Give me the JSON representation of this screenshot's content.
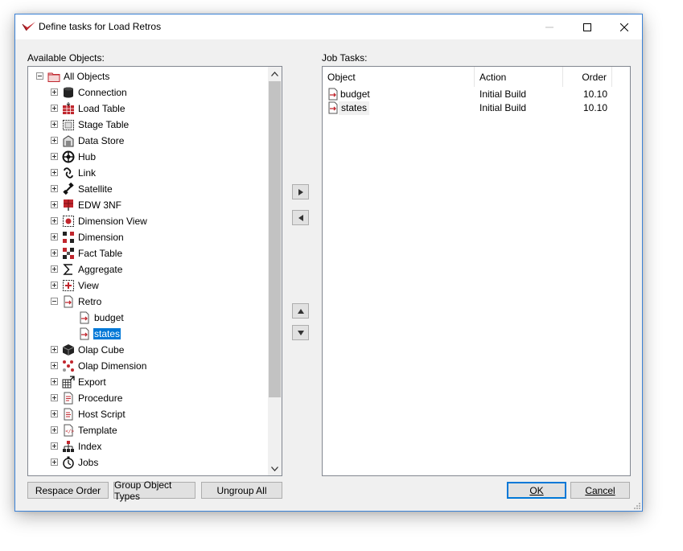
{
  "window": {
    "title": "Define tasks for Load Retros"
  },
  "left": {
    "label": "Available Objects:",
    "tree": [
      {
        "label": "All Objects",
        "icon": "folder-icon",
        "level": 0,
        "expander": "minus"
      },
      {
        "label": "Connection",
        "icon": "database-icon",
        "level": 1,
        "expander": "plus"
      },
      {
        "label": "Load Table",
        "icon": "load-table-icon",
        "level": 1,
        "expander": "plus"
      },
      {
        "label": "Stage Table",
        "icon": "stage-table-icon",
        "level": 1,
        "expander": "plus"
      },
      {
        "label": "Data Store",
        "icon": "data-store-icon",
        "level": 1,
        "expander": "plus"
      },
      {
        "label": "Hub",
        "icon": "hub-icon",
        "level": 1,
        "expander": "plus"
      },
      {
        "label": "Link",
        "icon": "link-icon",
        "level": 1,
        "expander": "plus"
      },
      {
        "label": "Satellite",
        "icon": "satellite-icon",
        "level": 1,
        "expander": "plus"
      },
      {
        "label": "EDW 3NF",
        "icon": "edw-icon",
        "level": 1,
        "expander": "plus"
      },
      {
        "label": "Dimension View",
        "icon": "dimension-view-icon",
        "level": 1,
        "expander": "plus"
      },
      {
        "label": "Dimension",
        "icon": "dimension-icon",
        "level": 1,
        "expander": "plus"
      },
      {
        "label": "Fact Table",
        "icon": "fact-table-icon",
        "level": 1,
        "expander": "plus"
      },
      {
        "label": "Aggregate",
        "icon": "sigma-icon",
        "level": 1,
        "expander": "plus"
      },
      {
        "label": "View",
        "icon": "view-icon",
        "level": 1,
        "expander": "plus"
      },
      {
        "label": "Retro",
        "icon": "retro-icon",
        "level": 1,
        "expander": "minus"
      },
      {
        "label": "budget",
        "icon": "retro-doc-icon",
        "level": 2,
        "expander": "none"
      },
      {
        "label": "states",
        "icon": "retro-doc-icon",
        "level": 2,
        "expander": "none",
        "selected": true
      },
      {
        "label": "Olap Cube",
        "icon": "cube-icon",
        "level": 1,
        "expander": "plus"
      },
      {
        "label": "Olap Dimension",
        "icon": "olap-dimension-icon",
        "level": 1,
        "expander": "plus"
      },
      {
        "label": "Export",
        "icon": "export-icon",
        "level": 1,
        "expander": "plus"
      },
      {
        "label": "Procedure",
        "icon": "procedure-icon",
        "level": 1,
        "expander": "plus"
      },
      {
        "label": "Host Script",
        "icon": "host-script-icon",
        "level": 1,
        "expander": "plus"
      },
      {
        "label": "Template",
        "icon": "template-icon",
        "level": 1,
        "expander": "plus"
      },
      {
        "label": "Index",
        "icon": "index-icon",
        "level": 1,
        "expander": "plus"
      },
      {
        "label": "Jobs",
        "icon": "jobs-icon",
        "level": 1,
        "expander": "plus"
      }
    ]
  },
  "right": {
    "label": "Job Tasks:",
    "columns": [
      "Object",
      "Action",
      "Order"
    ],
    "rows": [
      {
        "object": "budget",
        "action": "Initial Build",
        "order": "10.10",
        "icon": "retro-doc-icon"
      },
      {
        "object": "states",
        "action": "Initial Build",
        "order": "10.10",
        "icon": "retro-doc-icon"
      }
    ]
  },
  "buttons": {
    "respace": "Respace Order",
    "group": "Group Object Types",
    "ungroup": "Ungroup All",
    "ok": "OK",
    "cancel": "Cancel"
  },
  "colors": {
    "accent": "#0078d7",
    "icon_red": "#c0262d"
  }
}
